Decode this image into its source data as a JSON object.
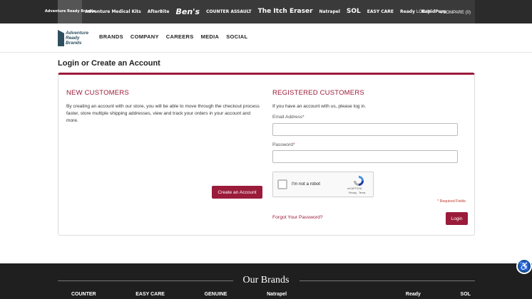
{
  "topbar": {
    "brands": [
      {
        "label": "Adventure Ready Brands",
        "size": "first"
      },
      {
        "label": "Adventure Medical Kits",
        "size": "sm"
      },
      {
        "label": "AfterBite",
        "size": "sm"
      },
      {
        "label": "Ben's",
        "size": "lg"
      },
      {
        "label": "COUNTER ASSAULT",
        "size": "sm"
      },
      {
        "label": "The Itch Eraser",
        "size": "md"
      },
      {
        "label": "Natrapel",
        "size": "sm"
      },
      {
        "label": "SOL",
        "size": "md"
      },
      {
        "label": "EASY CARE",
        "size": "sm"
      },
      {
        "label": "Ready",
        "size": "sm"
      },
      {
        "label": "RapidPure",
        "size": "sm"
      }
    ],
    "login_label": "LOG IN",
    "compare_label": "COMPARE (0)"
  },
  "nav": {
    "logo_text": [
      "Adventure",
      "Ready",
      "Brands"
    ],
    "items": [
      "BRANDS",
      "COMPANY",
      "CAREERS",
      "MEDIA",
      "SOCIAL"
    ]
  },
  "page_title": "Login or Create an Account",
  "new_customers": {
    "title": "NEW CUSTOMERS",
    "text": "By creating an account with our store, you will be able to move through the checkout process faster, store multiple shipping addresses, view and track your orders in your account and more.",
    "button_label": "Create an Account"
  },
  "registered_customers": {
    "title": "REGISTERED CUSTOMERS",
    "intro": "If you have an account with us, please log in.",
    "email_label": "Email Address",
    "password_label": "Password",
    "required_mark": "*",
    "captcha_text": "I'm not a robot",
    "captcha_brand": "reCAPTCHA",
    "captcha_terms": "Privacy - Terms",
    "required_note": "* Required Fields",
    "forgot_label": "Forgot Your Password?",
    "login_button_label": "Login"
  },
  "footer": {
    "title": "Our Brands",
    "brands": [
      "COUNTER",
      "EASY CARE",
      "GENUINE",
      "Natrapel",
      "",
      "",
      "Ready",
      "SOL"
    ]
  },
  "colors": {
    "accent": "#9b1b3a",
    "topbar": "#2b2b2b",
    "footer": "#1f1f1f"
  }
}
